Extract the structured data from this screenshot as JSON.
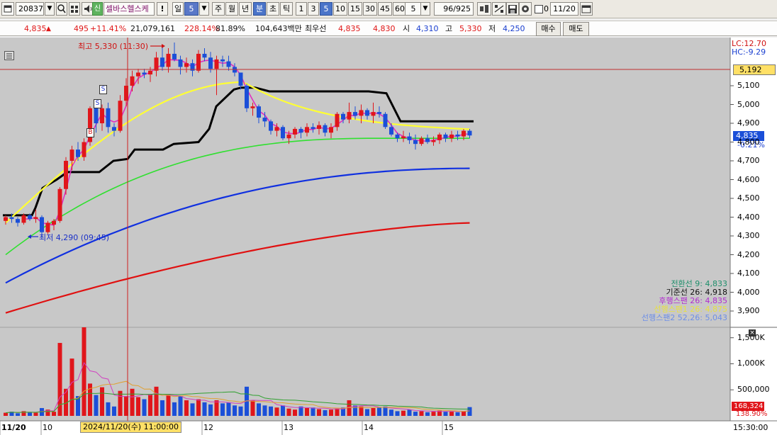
{
  "toolbar": {
    "code": "208370",
    "credit_badge": "신",
    "stock_name": "셀바스헬스케",
    "excl": "!",
    "period_day": "일",
    "period_min_val": "5",
    "btn_week": "주",
    "btn_month": "월",
    "btn_year": "년",
    "btn_min": "분",
    "btn_sec": "초",
    "btn_tick": "틱",
    "intervals": [
      "1",
      "3",
      "5",
      "10",
      "15",
      "30",
      "45",
      "60"
    ],
    "active_interval": "5",
    "count_value": "5",
    "page_counter": "96/925",
    "checkbox_label": "0",
    "date_value": "11/20"
  },
  "price_bar": {
    "price": "4,835",
    "up_arrow": "▲",
    "change": "495",
    "change_pct": "+11.41%",
    "volume": "21,079,161",
    "volume_ratio": "228.14%",
    "ratio2": "81.89%",
    "amount": "104,643백만",
    "best_label": "최우선",
    "best_ask": "4,835",
    "best_bid": "4,830",
    "open_label": "시",
    "open_value": "4,310",
    "high_label": "고",
    "high_value": "5,330",
    "low_label": "저",
    "low_value": "4,250",
    "buy_label": "매수",
    "sell_label": "매도"
  },
  "chart": {
    "lc_label": "LC:12.70",
    "hc_label": "HC:-9.29",
    "high_annotation": "최고 5,330 (11:30)",
    "low_annotation": "최저 4,290 (09:45)",
    "current_price_box": "4,835",
    "current_pct": "-0.21%",
    "ref_price_box": "5,192",
    "y_ticks": [
      "5,100",
      "5,000",
      "4,900",
      "4,800",
      "4,700",
      "4,600",
      "4,500",
      "4,400",
      "4,300",
      "4,200",
      "4,100",
      "4,000",
      "3,900"
    ],
    "legend": [
      {
        "label": "전환선 9: 4,833",
        "color": "#1f8f6b"
      },
      {
        "label": "기준선 26: 4,918",
        "color": "#111111"
      },
      {
        "label": "후행스팬 26: 4,835",
        "color": "#b12cd0"
      },
      {
        "label": "선행스팬1 26: 4,875",
        "color": "#e8e040"
      },
      {
        "label": "선행스팬2 52,26: 5,043",
        "color": "#6c8ee8"
      }
    ],
    "signal_s": "S",
    "signal_b": "B",
    "vol_ticks": [
      "1,500K",
      "1,000K",
      "500,000"
    ],
    "vol_box": "168,324",
    "vol_pct": "138.90%",
    "x_labels": [
      "11/20",
      "10",
      "12",
      "13",
      "14",
      "15"
    ],
    "crosshair_time": "2024/11/20(수) 11:00:00",
    "end_time": "15:30:00"
  },
  "colors": {
    "up": "#e0161b",
    "down": "#1b4fd8",
    "chart_bg": "#c8c8c8",
    "ma_yellow": "#ffff33",
    "ma_magenta": "#e030c0",
    "ma_green": "#30e030",
    "ma_blue": "#1030e0",
    "ma_red": "#e01010",
    "base_line": "#000000"
  }
}
